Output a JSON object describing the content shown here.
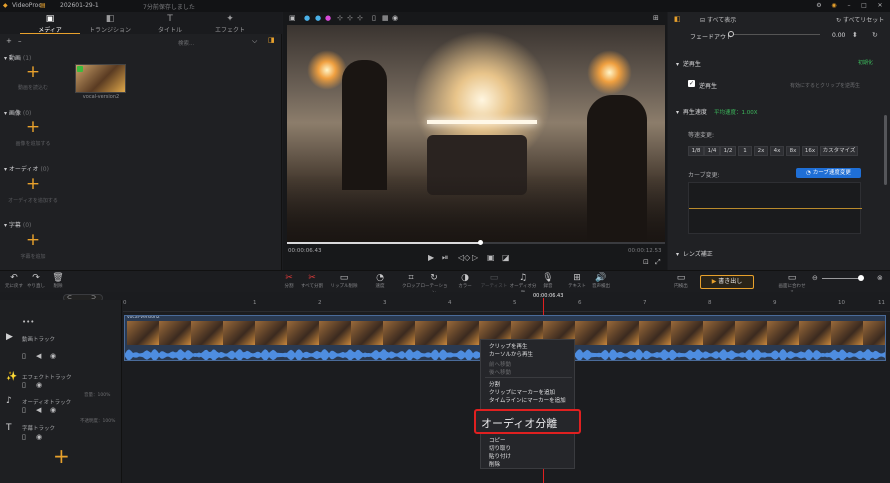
{
  "titlebar": {
    "app": "VideoProc",
    "project": "202601-29-1",
    "saved": "7分前保存しました"
  },
  "tabs": [
    {
      "label": "メディア",
      "icon": "▣"
    },
    {
      "label": "トランジション",
      "icon": "◧"
    },
    {
      "label": "タイトル",
      "icon": "T"
    },
    {
      "label": "エフェクト",
      "icon": "✦"
    }
  ],
  "left": {
    "search": "検索...",
    "sections": [
      {
        "label": "動画",
        "count": "(1)",
        "hint": "動画を読込む"
      },
      {
        "label": "画像",
        "count": "(0)",
        "hint": "画像を追加する"
      },
      {
        "label": "オーディオ",
        "count": "(0)",
        "hint": "オーディオを追加する"
      },
      {
        "label": "字幕",
        "count": "(0)",
        "hint": "字幕を追加"
      }
    ],
    "thumb": "vocal-version2"
  },
  "preview": {
    "time_cur": "00:00:06.43",
    "time_total": "00:00:12.53"
  },
  "right": {
    "show_all": "すべて表示",
    "reset_all": "すべてリセット",
    "fadeout": "フェードアウト",
    "fadeout_val": "0.00",
    "reverse": "逆再生",
    "reverse_on": "逆再生",
    "reverse_hint": "有効にするとクリップを逆再生",
    "speed": "再生速度",
    "avg_speed": "平均速度：1.00X",
    "uniform": "等速変更:",
    "speeds": [
      "1/8",
      "1/4",
      "1/2",
      "1",
      "2x",
      "4x",
      "8x",
      "16x",
      "カスタマイズ"
    ],
    "curve": "カーブ変更:",
    "curve_btn": "カーブ速度変更",
    "lens": "レンズ補正",
    "green": "初期化"
  },
  "toolbar": {
    "left": [
      {
        "l": "元に戻す",
        "i": "↶"
      },
      {
        "l": "やり直し",
        "i": "↷"
      },
      {
        "l": "削除",
        "i": "🗑"
      }
    ],
    "center": [
      {
        "l": "分割",
        "i": "✂"
      },
      {
        "l": "すべて分割",
        "i": "✂"
      },
      {
        "l": "リップル削除",
        "i": "▭"
      },
      {
        "l": "速度",
        "i": "◔"
      },
      {
        "l": "クロップ",
        "i": "⌗"
      },
      {
        "l": "ローテーション",
        "i": "↻"
      },
      {
        "l": "カラー",
        "i": "◑"
      },
      {
        "l": "アーティスト",
        "i": "▭"
      },
      {
        "l": "オーディオ分離",
        "i": "♫"
      },
      {
        "l": "録音",
        "i": "🎙"
      },
      {
        "l": "テキスト",
        "i": "⊞"
      },
      {
        "l": "音声検出",
        "i": "🔊"
      }
    ],
    "right": [
      {
        "l": "円検出",
        "i": "▭"
      },
      {
        "l": "画面に合わせる",
        "i": "▭"
      }
    ],
    "export": "書き出し"
  },
  "ruler": {
    "playhead": "00:00:06.43",
    "ticks": [
      "1",
      "2",
      "3",
      "4",
      "5",
      "6",
      "7",
      "8",
      "9",
      "10",
      "11"
    ]
  },
  "tracks": [
    {
      "label": "動画トラック",
      "icon": "▶"
    },
    {
      "label": "エフェクトトラック",
      "icon": "✨"
    },
    {
      "label": "オーディオトラック",
      "icon": "♪",
      "tag": "音量：100%"
    },
    {
      "label": "字幕トラック",
      "icon": "T",
      "tag": "不透明度：100%"
    }
  ],
  "clip": {
    "name": "vocal-version2"
  },
  "menu": {
    "items": [
      {
        "l": "クリップを再生",
        "d": false
      },
      {
        "l": "カーソルから再生",
        "d": false
      },
      {
        "l": "前へ移動",
        "d": true
      },
      {
        "l": "後へ移動",
        "d": true
      },
      {
        "l": "分割",
        "d": false
      },
      {
        "l": "クリップにマーカーを追加",
        "d": false
      },
      {
        "l": "タイムラインにマーカーを追加",
        "d": false
      }
    ],
    "highlight": "オーディオ分離",
    "bottom": [
      {
        "l": "コピー"
      },
      {
        "l": "切り取り"
      },
      {
        "l": "貼り付け"
      },
      {
        "l": "削除"
      }
    ]
  }
}
